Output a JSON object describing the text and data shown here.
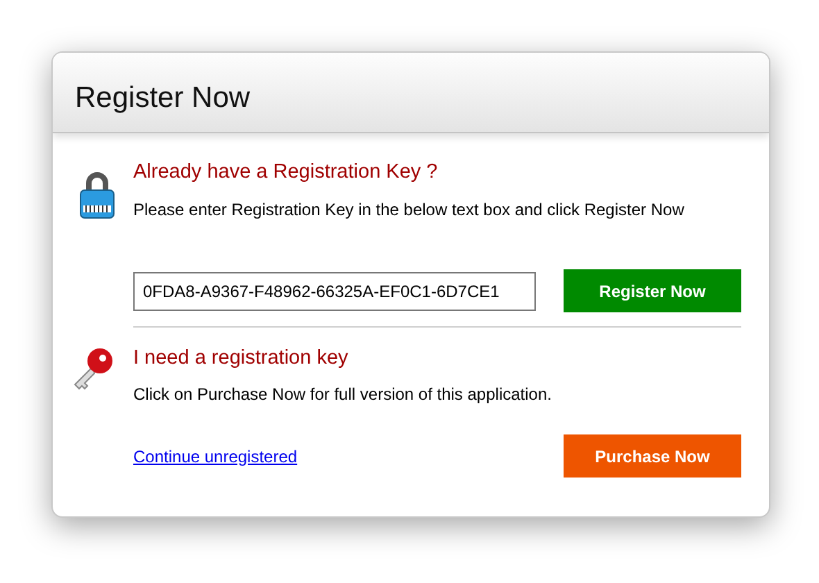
{
  "window": {
    "title": "Register Now"
  },
  "have_key": {
    "heading": "Already have a Registration Key ?",
    "instruction": "Please enter Registration Key in the below text box and click Register Now",
    "key_field": {
      "value": "0FDA8-A9367-F48962-66325A-EF0C1-6D7CE1"
    },
    "button": "Register Now"
  },
  "need_key": {
    "heading": "I need a registration key",
    "instruction": "Click on Purchase Now for full version of this application.",
    "link": "Continue unregistered",
    "button": "Purchase Now"
  }
}
